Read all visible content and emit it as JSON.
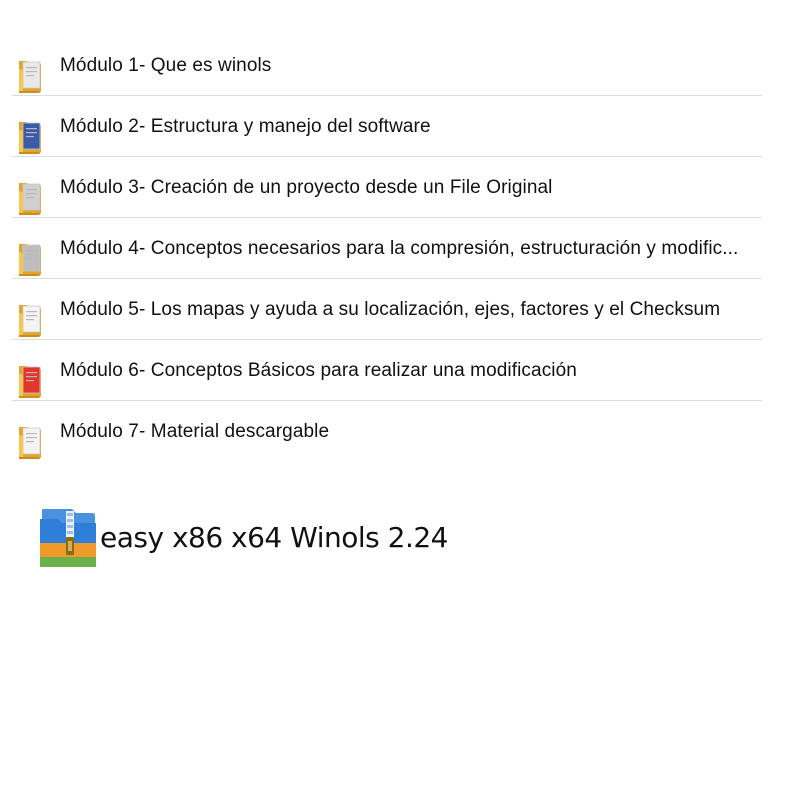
{
  "folders": [
    {
      "label": "Módulo 1- Que es winols",
      "icon": "folder-icon",
      "doc_color": "#e9e9e9",
      "accent": "#f5c84c"
    },
    {
      "label": "Módulo 2- Estructura y manejo del software",
      "icon": "folder-icon",
      "doc_color": "#3a5ba8",
      "accent": "#f5c84c"
    },
    {
      "label": "Módulo 3- Creación de un proyecto desde un File Original",
      "icon": "folder-icon",
      "doc_color": "#cfcfcf",
      "accent": "#f5c84c"
    },
    {
      "label": "Módulo 4- Conceptos necesarios para la compresión, estructuración y modific...",
      "icon": "folder-icon",
      "doc_color": "#bdbdbd",
      "accent": "#f5c84c"
    },
    {
      "label": "Módulo 5- Los mapas y ayuda a su localización, ejes, factores y el Checksum",
      "icon": "folder-icon",
      "doc_color": "#f4f4f4",
      "accent": "#f5c84c"
    },
    {
      "label": "Módulo 6- Conceptos Básicos para realizar una modificación",
      "icon": "folder-icon",
      "doc_color": "#e0362c",
      "accent": "#f5c84c"
    },
    {
      "label": "Módulo 7- Material descargable",
      "icon": "folder-icon",
      "doc_color": "#f4f4f4",
      "accent": "#f5c84c"
    }
  ],
  "archive": {
    "label": "easy x86 x64 Winols 2.24",
    "icon": "archive-icon",
    "colors": {
      "blue": "#2f7ed8",
      "orange": "#f09a2a",
      "green": "#6ab04c"
    }
  }
}
